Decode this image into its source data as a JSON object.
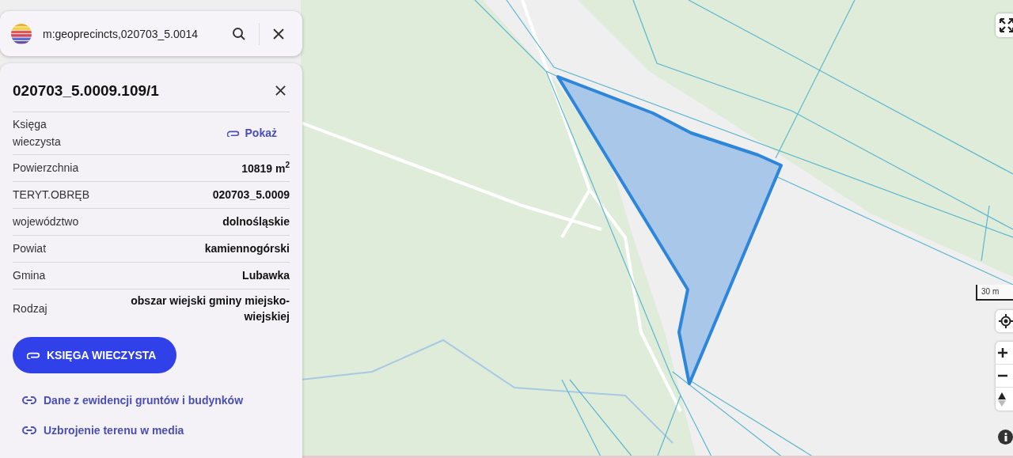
{
  "search": {
    "value": "m:geoprecincts,020703_5.0014"
  },
  "parcel": {
    "title": "020703_5.0009.109/1",
    "rows": [
      {
        "label": "Księga wieczysta",
        "kind": "link",
        "value": "Pokaż"
      },
      {
        "label": "Powierzchnia",
        "kind": "text",
        "value": "10819 m$^{2}$"
      },
      {
        "label": "TERYT.OBRĘB",
        "kind": "text",
        "value": "020703_5.0009"
      },
      {
        "label": "województwo",
        "kind": "text",
        "value": "dolnośląskie"
      },
      {
        "label": "Powiat",
        "kind": "text",
        "value": "kamiennogórski"
      },
      {
        "label": "Gmina",
        "kind": "text",
        "value": "Lubawka"
      },
      {
        "label": "Rodzaj",
        "kind": "text",
        "value": "obszar wiejski gminy miejsko-wiejskiej"
      }
    ]
  },
  "primary_button": "KSIĘGA WIECZYSTA",
  "links": [
    "Dane z ewidencji gruntów i budynków",
    "Uzbrojenie terenu w media"
  ],
  "scale": "30 m"
}
